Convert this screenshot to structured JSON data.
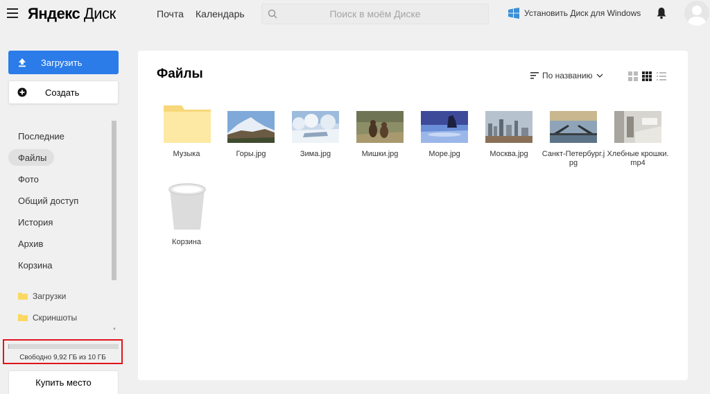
{
  "header": {
    "logo_brand": "Яндекс",
    "logo_product": "Диск",
    "nav": [
      "Почта",
      "Календарь"
    ],
    "search_placeholder": "Поиск в моём Диске",
    "install_label": "Установить Диск для Windows"
  },
  "sidebar": {
    "upload_label": "Загрузить",
    "create_label": "Создать",
    "items": [
      {
        "label": "Последние"
      },
      {
        "label": "Файлы",
        "active": true
      },
      {
        "label": "Фото"
      },
      {
        "label": "Общий доступ"
      },
      {
        "label": "История"
      },
      {
        "label": "Архив"
      },
      {
        "label": "Корзина"
      }
    ],
    "folders": [
      {
        "label": "Загрузки"
      },
      {
        "label": "Скриншоты"
      }
    ],
    "storage": {
      "text": "Свободно 9,92 ГБ из 10 ГБ",
      "used_fraction": 0.008
    },
    "buy_label": "Купить место"
  },
  "main": {
    "title": "Файлы",
    "sort_label": "По названию",
    "files": [
      {
        "name": "Музыка",
        "type": "folder-icon"
      },
      {
        "name": "Горы.jpg",
        "type": "mountain-photo"
      },
      {
        "name": "Зима.jpg",
        "type": "winter-photo"
      },
      {
        "name": "Мишки.jpg",
        "type": "bears-photo"
      },
      {
        "name": "Море.jpg",
        "type": "sea-photo"
      },
      {
        "name": "Москва.jpg",
        "type": "city-photo"
      },
      {
        "name": "Санкт-Петербург.jpg",
        "type": "bridge-photo"
      },
      {
        "name": "Хлебные крошки.mp4",
        "type": "video-thumbnail"
      },
      {
        "name": "Корзина",
        "type": "trash-bin-icon"
      }
    ]
  },
  "colors": {
    "accent": "#2b7ce9",
    "highlight_border": "#e0141b",
    "folder": "#fde9a4",
    "background": "#f0f0f0"
  }
}
